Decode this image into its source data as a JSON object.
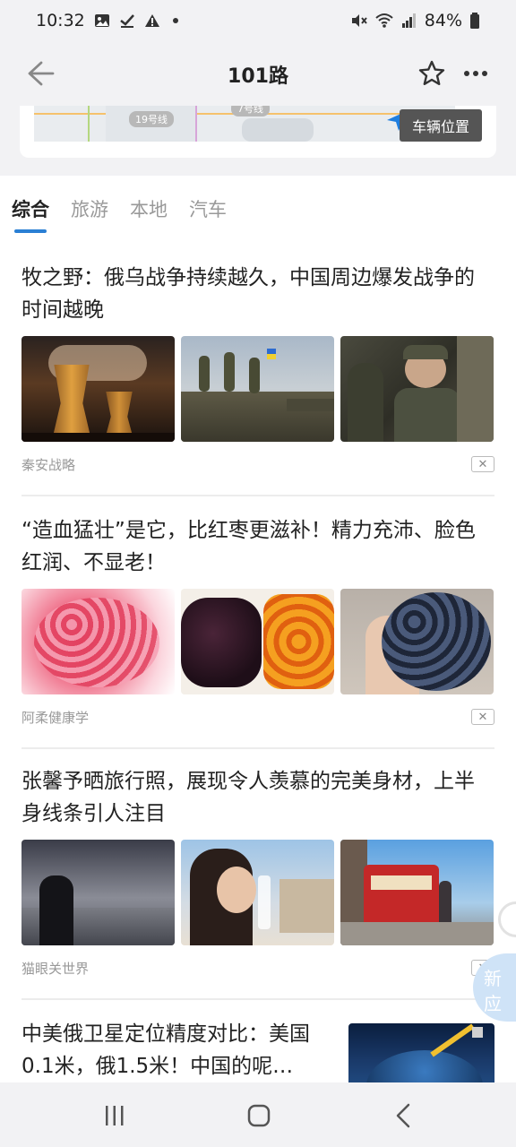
{
  "status_bar": {
    "time": "10:32",
    "battery": "84%",
    "icons": [
      "image-icon",
      "check-icon",
      "warning-icon",
      "dot-icon",
      "mute-icon",
      "wifi-icon",
      "signal-icon",
      "battery-icon"
    ]
  },
  "header": {
    "title": "101路"
  },
  "map": {
    "label_line_19": "19号线",
    "label_line_7": "7号线",
    "vehicle_position_button": "车辆位置"
  },
  "tabs": [
    {
      "label": "综合",
      "active": true
    },
    {
      "label": "旅游",
      "active": false
    },
    {
      "label": "本地",
      "active": false
    },
    {
      "label": "汽车",
      "active": false
    }
  ],
  "articles": [
    {
      "title": "牧之野：俄乌战争持续越久，中国周边爆发战争的时间越晚",
      "source": "秦安战略",
      "thumbs": [
        "cooling-towers",
        "soldiers-on-tank",
        "soldiers-group"
      ]
    },
    {
      "title": "“造血猛壮”是它，比红枣更滋补！精力充沛、脸色红润、不显老！",
      "source": "阿柔健康学",
      "thumbs": [
        "red-balls",
        "dark-berries-and-orange",
        "grapes-in-hand"
      ]
    },
    {
      "title": "张馨予晒旅行照，展现令人羡慕的完美身材，上半身线条引人注目",
      "source": "猫眼关世界",
      "thumbs": [
        "woman-at-dusk",
        "woman-drinking",
        "red-tram-street"
      ]
    },
    {
      "title": "中美俄卫星定位精度对比：美国0.1米，俄1.5米！中国的呢…",
      "thumbs": [
        "satellite-globe"
      ]
    }
  ],
  "floating_bubble": {
    "chars": [
      "新",
      "应"
    ]
  },
  "nav_bar": {
    "icons": [
      "recent-apps-icon",
      "home-icon",
      "back-icon"
    ]
  }
}
